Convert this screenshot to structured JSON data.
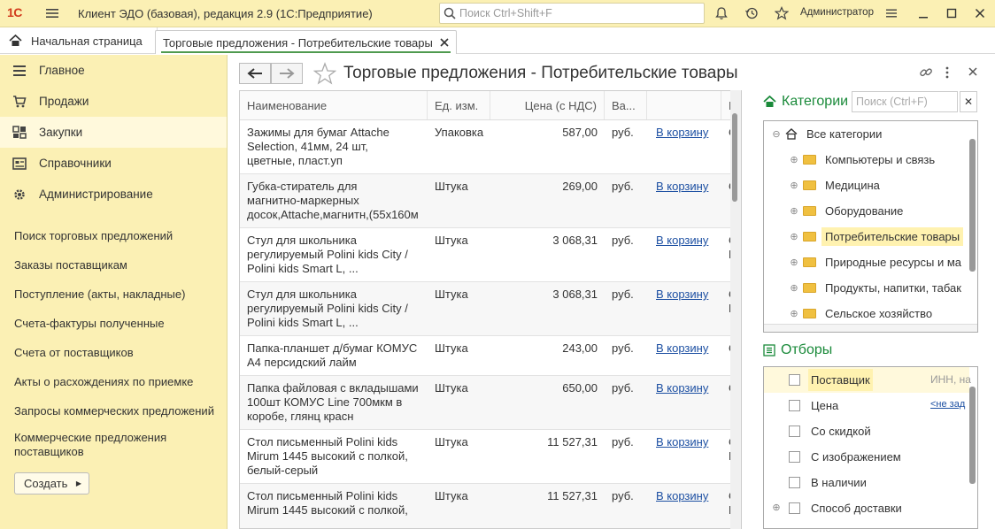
{
  "titlebar": {
    "logo": "1С",
    "app_title": "Клиент ЭДО (базовая), редакция 2.9  (1С:Предприятие)",
    "search_placeholder": "Поиск Ctrl+Shift+F",
    "user": "Администратор"
  },
  "tabs": {
    "home": "Начальная страница",
    "active": "Торговые предложения - Потребительские товары"
  },
  "sidebar": {
    "sections": [
      {
        "label": "Главное",
        "icon": "menu-lines-icon"
      },
      {
        "label": "Продажи",
        "icon": "cart-icon"
      },
      {
        "label": "Закупки",
        "icon": "purchases-icon"
      },
      {
        "label": "Справочники",
        "icon": "catalog-icon"
      },
      {
        "label": "Администрирование",
        "icon": "gear-icon"
      }
    ],
    "selected": "Закупки",
    "links": [
      "Поиск торговых предложений",
      "Заказы поставщикам",
      "Поступление (акты, накладные)",
      "Счета-фактуры полученные",
      "Счета от поставщиков",
      "Акты о расхождениях по приемке",
      "Запросы коммерческих предложений",
      "Коммерческие предложения поставщиков"
    ],
    "create_button": "Создать"
  },
  "form": {
    "title": "Торговые предложения - Потребительские товары"
  },
  "table": {
    "columns": [
      "Наименование",
      "Ед. изм.",
      "Цена (с НДС)",
      "Ва...",
      "",
      "По"
    ],
    "rows": [
      {
        "name": [
          "Зажимы для бумаг Attache",
          "Selection, 41мм, 24 шт,",
          "цветные, пласт.уп"
        ],
        "unit": "Упаковка",
        "price": "587,00",
        "currency": "руб.",
        "action": "В корзину",
        "supplier": [
          "ОС"
        ]
      },
      {
        "name": [
          "Губка-стиратель для",
          "магнитно-маркерных",
          "досок,Attache,магнитн,(55х160м"
        ],
        "unit": "Штука",
        "price": "269,00",
        "currency": "руб.",
        "action": "В корзину",
        "supplier": [
          "ОС"
        ]
      },
      {
        "name": [
          "Стул для школьника",
          "регулируемый Polini kids City /",
          "Polini kids Smart L, ..."
        ],
        "unit": "Штука",
        "price": "3 068,31",
        "currency": "руб.",
        "action": "В корзину",
        "supplier": [
          "ОА",
          "ПР"
        ]
      },
      {
        "name": [
          "Стул для школьника",
          "регулируемый Polini kids City /",
          "Polini kids Smart L, ..."
        ],
        "unit": "Штука",
        "price": "3 068,31",
        "currency": "руб.",
        "action": "В корзину",
        "supplier": [
          "ОА",
          "ПР"
        ]
      },
      {
        "name": [
          "Папка-планшет д/бумаг КОМУС",
          "А4 персидский лайм"
        ],
        "unit": "Штука",
        "price": "243,00",
        "currency": "руб.",
        "action": "В корзину",
        "supplier": [
          "ОС"
        ]
      },
      {
        "name": [
          "Папка файловая с вкладышами",
          "100шт КОМУС Line 700мкм в",
          "коробе, глянц красн"
        ],
        "unit": "Штука",
        "price": "650,00",
        "currency": "руб.",
        "action": "В корзину",
        "supplier": [
          "ОС"
        ]
      },
      {
        "name": [
          "Стол письменный Polini kids",
          "Mirum 1445 высокий с полкой,",
          "белый-серый"
        ],
        "unit": "Штука",
        "price": "11 527,31",
        "currency": "руб.",
        "action": "В корзину",
        "supplier": [
          "ОА",
          "ПР"
        ]
      },
      {
        "name": [
          "Стол письменный Polini kids",
          "Mirum 1445 высокий с полкой,",
          ""
        ],
        "unit": "Штука",
        "price": "11 527,31",
        "currency": "руб.",
        "action": "В корзину",
        "supplier": [
          "ОА",
          "ПР"
        ]
      }
    ]
  },
  "categories": {
    "title": "Категории",
    "search_placeholder": "Поиск (Ctrl+F)",
    "root": "Все категории",
    "items": [
      "Компьютеры и связь",
      "Медицина",
      "Оборудование",
      "Потребительские товары",
      "Природные ресурсы и ма",
      "Продукты, напитки, табак",
      "Сельское хозяйство"
    ],
    "selected": "Потребительские товары"
  },
  "filters": {
    "title": "Отборы",
    "items": [
      {
        "label": "Поставщик",
        "value": "ИНН, на"
      },
      {
        "label": "Цена",
        "value": "<не зад"
      },
      {
        "label": "Со скидкой",
        "value": ""
      },
      {
        "label": "С изображением",
        "value": ""
      },
      {
        "label": "В наличии",
        "value": ""
      },
      {
        "label": "Способ доставки",
        "value": ""
      }
    ]
  },
  "colors": {
    "sidebar_bg": "#fbf0b4",
    "accent_green": "#1a8a3a",
    "link_blue": "#1c4fa2",
    "selection": "#fff2b0"
  }
}
